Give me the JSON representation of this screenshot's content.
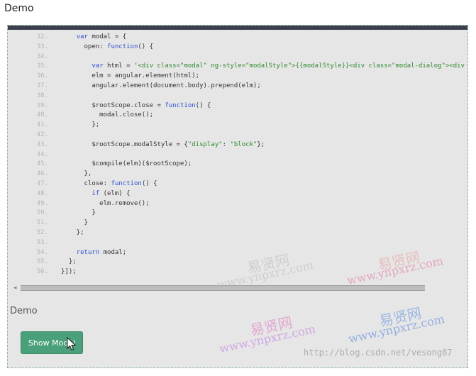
{
  "page_title": "Demo",
  "code": {
    "lines": [
      {
        "n": "32.",
        "parts": [
          {
            "t": "    "
          },
          {
            "t": "var",
            "c": "kw"
          },
          {
            "t": " modal = {"
          }
        ]
      },
      {
        "n": "33.",
        "parts": [
          {
            "t": "      open: "
          },
          {
            "t": "function",
            "c": "kw"
          },
          {
            "t": "() {"
          }
        ]
      },
      {
        "n": "34.",
        "parts": [
          {
            "t": ""
          }
        ]
      },
      {
        "n": "35.",
        "parts": [
          {
            "t": "        "
          },
          {
            "t": "var",
            "c": "kw"
          },
          {
            "t": " html = '"
          },
          {
            "t": "<div class=\"modal\" ng-style=\"modalStyle\">{{modalStyle}}<div class=\"modal-dialog\"><div class=\"",
            "c": "str"
          }
        ]
      },
      {
        "n": "36.",
        "parts": [
          {
            "t": "        elm = angular.element(html);"
          }
        ]
      },
      {
        "n": "37.",
        "parts": [
          {
            "t": "        angular.element(document.body).prepend(elm);"
          }
        ]
      },
      {
        "n": "38.",
        "parts": [
          {
            "t": ""
          }
        ]
      },
      {
        "n": "39.",
        "parts": [
          {
            "t": "        $rootScope.close = "
          },
          {
            "t": "function",
            "c": "kw"
          },
          {
            "t": "() {"
          }
        ]
      },
      {
        "n": "40.",
        "parts": [
          {
            "t": "          modal.close();"
          }
        ]
      },
      {
        "n": "41.",
        "parts": [
          {
            "t": "        };"
          }
        ]
      },
      {
        "n": "42.",
        "parts": [
          {
            "t": ""
          }
        ]
      },
      {
        "n": "43.",
        "parts": [
          {
            "t": "        $rootScope.modalStyle = {"
          },
          {
            "t": "\"display\"",
            "c": "str"
          },
          {
            "t": ": "
          },
          {
            "t": "\"block\"",
            "c": "str"
          },
          {
            "t": "};"
          }
        ]
      },
      {
        "n": "44.",
        "parts": [
          {
            "t": ""
          }
        ]
      },
      {
        "n": "45.",
        "parts": [
          {
            "t": "        $compile(elm)($rootScope);"
          }
        ]
      },
      {
        "n": "46.",
        "parts": [
          {
            "t": "      },"
          }
        ]
      },
      {
        "n": "47.",
        "parts": [
          {
            "t": "      close: "
          },
          {
            "t": "function",
            "c": "kw"
          },
          {
            "t": "() {"
          }
        ]
      },
      {
        "n": "48.",
        "parts": [
          {
            "t": "        "
          },
          {
            "t": "if",
            "c": "kw"
          },
          {
            "t": " (elm) {"
          }
        ]
      },
      {
        "n": "49.",
        "parts": [
          {
            "t": "          elm.remove();"
          }
        ]
      },
      {
        "n": "50.",
        "parts": [
          {
            "t": "        }"
          }
        ]
      },
      {
        "n": "51.",
        "parts": [
          {
            "t": "      }"
          }
        ]
      },
      {
        "n": "52.",
        "parts": [
          {
            "t": "    };"
          }
        ]
      },
      {
        "n": "53.",
        "parts": [
          {
            "t": ""
          }
        ]
      },
      {
        "n": "54.",
        "parts": [
          {
            "t": "    "
          },
          {
            "t": "return",
            "c": "kw"
          },
          {
            "t": " modal;"
          }
        ]
      },
      {
        "n": "55.",
        "parts": [
          {
            "t": "  };"
          }
        ]
      },
      {
        "n": "56.",
        "parts": [
          {
            "t": "}]);"
          }
        ]
      }
    ]
  },
  "demo_heading": "Demo",
  "show_modal_button": "Show Modal",
  "watermarks": [
    {
      "text": "易贤网",
      "kind": "cn",
      "color": "#bbbbbb"
    },
    {
      "text": "www.ynpxrz.com",
      "kind": "en",
      "color": "#bbbbbb"
    },
    {
      "text": "易贤网",
      "kind": "cn",
      "color": "#e8a0a0"
    },
    {
      "text": "www.ynpxrz.com",
      "kind": "en",
      "color": "#e070a0"
    },
    {
      "text": "易贤网",
      "kind": "cn",
      "color": "#e070c0"
    },
    {
      "text": "www.ynpxrz.com",
      "kind": "en",
      "color": "#c070e0"
    },
    {
      "text": "易贤网",
      "kind": "cn",
      "color": "#6090e0"
    },
    {
      "text": "www.ynpxrz.com",
      "kind": "en",
      "color": "#5080e0"
    },
    {
      "text": "http://blog.csdn.net/vesong87",
      "kind": "url",
      "color": "#9e9e9e"
    }
  ]
}
